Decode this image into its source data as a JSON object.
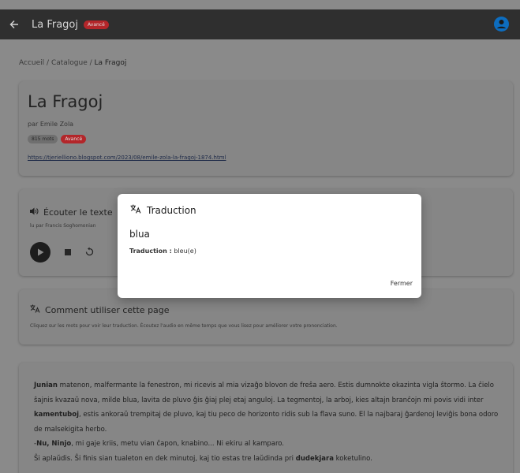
{
  "header": {
    "title": "La Fragoj",
    "level_badge": "Avancé"
  },
  "breadcrumb": {
    "home": "Accueil",
    "sep1": "/",
    "catalog": "Catalogue",
    "sep2": "/",
    "current": "La Fragoj"
  },
  "book": {
    "title": "La Fragoj",
    "author": "par Emile Zola",
    "word_count": "815 mots",
    "level": "Avancé",
    "source_link": "https://tjerielliono.blogspot.com/2023/08/emile-zola-la-fragoj-1874.html"
  },
  "audio": {
    "title": "Écouter le texte",
    "reader": "lu par Francis Soghomonian"
  },
  "help": {
    "title": "Comment utiliser cette page",
    "text": "Cliquez sur les mots pour voir leur traduction. Écoutez l'audio en même temps que vous lisez pour améliorer votre prononciation."
  },
  "story": {
    "p1": [
      {
        "t": "Junian",
        "b": true
      },
      {
        "t": " matenon, malfermante la fenestron, mi ricevis al mia vizaĝo blovon de freŝa aero. Estis dumnokte okazinta vigla ŝtormo. La ĉielo ŝajnis kvazaŭ nova, milde blua, lavita de pluvo ĝis ĝiaj plej etaj anguloj. La tegmentoj, la arboj, kies altajn branĉojn mi povis vidi inter ",
        "b": false
      },
      {
        "t": "kamentuboj",
        "b": true
      },
      {
        "t": ", estis ankoraŭ trempitaj de pluvo, kaj tiu peco de horizonto ridis sub la flava suno. El la najbaraj ĝardenoj leviĝis bona odoro de malsekigita herbo.",
        "b": false
      }
    ],
    "p2": [
      {
        "t": "-",
        "b": false
      },
      {
        "t": "Nu, Ninjo",
        "b": true
      },
      {
        "t": ", mi gaje kriis, metu vian ĉapon, knabino... Ni ekiru al kamparo.",
        "b": false
      }
    ],
    "p3": [
      {
        "t": "Ŝi aplaŭdis. Ŝi finis sian tualeton en dek minutoj, kaj tio estas tre laŭdinda pri ",
        "b": false
      },
      {
        "t": "dudekjara",
        "b": true
      },
      {
        "t": " koketulino.",
        "b": false
      }
    ]
  },
  "modal": {
    "title": "Traduction",
    "word": "blua",
    "label": "Traduction :",
    "value": "bleu(e)",
    "close": "Fermer"
  },
  "colors": {
    "badge": "#b3262a",
    "avatar": "#0d6dbf",
    "topbar": "#2f2f2f"
  },
  "icons": {
    "back": "arrow-left-icon",
    "avatar": "user-circle-icon",
    "speaker": "speaker-icon",
    "translate": "translate-icon"
  }
}
